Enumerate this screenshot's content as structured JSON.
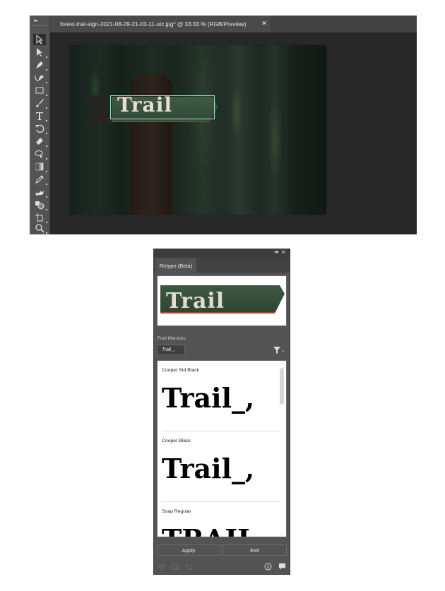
{
  "photoshop": {
    "document_tab": {
      "title": "forest-trail-sign-2021-08-29-21-03-11-utc.jpg* @ 33.33 % (RGB/Preview)",
      "close_glyph": "×"
    },
    "toolbar": {
      "grip_glyph": "▸▸",
      "tools": [
        {
          "name": "selection-tool",
          "icon": "selection-arrow-icon",
          "active": true
        },
        {
          "name": "direct-selection-tool",
          "icon": "direct-selection-arrow-icon"
        },
        {
          "name": "pen-tool",
          "icon": "pen-icon"
        },
        {
          "name": "curvature-pen-tool",
          "icon": "curvature-pen-icon"
        },
        {
          "name": "rectangle-tool",
          "icon": "rectangle-icon"
        },
        {
          "name": "brush-tool",
          "icon": "brush-icon"
        },
        {
          "name": "type-tool",
          "icon": "type-icon"
        },
        {
          "name": "rotate-tool",
          "icon": "rotate-icon"
        },
        {
          "name": "eraser-tool",
          "icon": "eraser-icon"
        },
        {
          "name": "lasso-tool",
          "icon": "lasso-icon"
        },
        {
          "name": "gradient-tool",
          "icon": "gradient-icon"
        },
        {
          "name": "eyedropper-tool",
          "icon": "eyedropper-icon"
        },
        {
          "name": "puppet-warp-tool",
          "icon": "puppet-warp-icon"
        },
        {
          "name": "shape-builder-tool",
          "icon": "shape-builder-icon"
        },
        {
          "name": "artboard-tool",
          "icon": "artboard-icon"
        },
        {
          "name": "zoom-tool",
          "icon": "zoom-icon"
        }
      ]
    },
    "canvas": {
      "sign_text": "Trail"
    }
  },
  "retype_panel": {
    "collapse_glyph": "◂◂",
    "close_glyph": "✕",
    "tab_label": "Retype (Beta)",
    "preview_text": "Trail",
    "font_matches_label": "Font Matches:",
    "sample_text": "Trail_,",
    "filter_chevron": "⌄",
    "results": [
      {
        "font_name": "Cooper Std Black",
        "sample": "Trail_,"
      },
      {
        "font_name": "Cooper Black",
        "sample": "Trail_,"
      },
      {
        "font_name": "Soap Regular",
        "sample": "TRAIL"
      }
    ],
    "scroll_up_glyph": "⌃",
    "scroll_down_glyph": "⌄",
    "apply_label": "Apply",
    "exit_label": "Exit",
    "footer_icons": [
      "visibility-icon",
      "replace-icon",
      "undo-icon",
      "info-icon",
      "feedback-icon"
    ]
  }
}
